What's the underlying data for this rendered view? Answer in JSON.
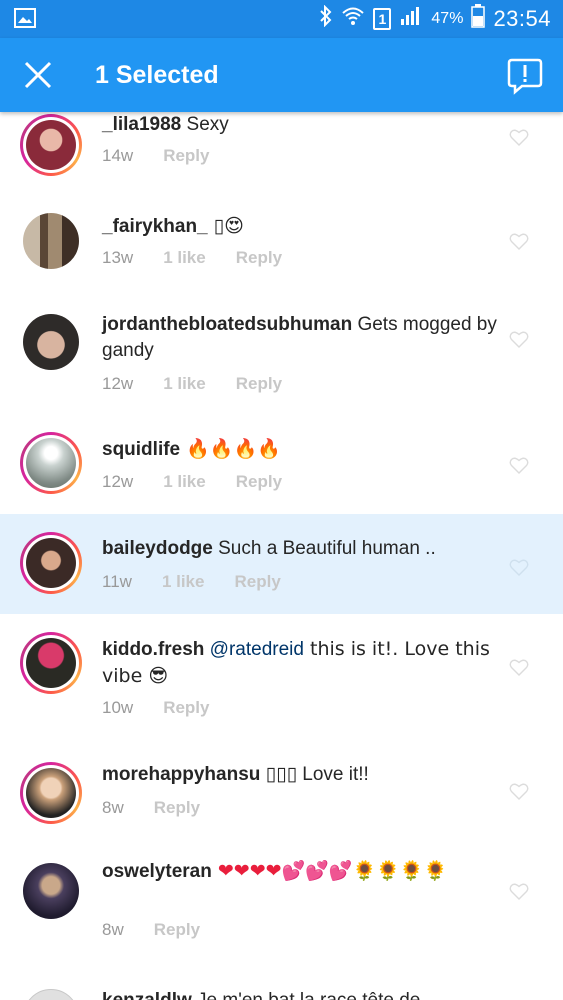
{
  "status_bar": {
    "sim": "1",
    "battery": "47%",
    "time": "23:54"
  },
  "action_bar": {
    "title": "1 Selected"
  },
  "comments": [
    {
      "username": "_lila1988",
      "text": " Sexy",
      "time": "14w",
      "likes": "",
      "reply": "Reply",
      "story": true,
      "selected": false,
      "avatar_color": "#8a2a3a"
    },
    {
      "username": "_fairykhan_",
      "text": " ▯😍",
      "time": "13w",
      "likes": "1 like",
      "reply": "Reply",
      "story": false,
      "selected": false,
      "avatar_color": "#7a6450"
    },
    {
      "username": "jordanthebloatedsubhuman",
      "text": " Gets mogged by gandy",
      "time": "12w",
      "likes": "1 like",
      "reply": "Reply",
      "story": false,
      "selected": false,
      "avatar_color": "#5a5550"
    },
    {
      "username": "squidlife",
      "text": " 🔥🔥🔥🔥",
      "time": "12w",
      "likes": "1 like",
      "reply": "Reply",
      "story": true,
      "selected": false,
      "avatar_color": "#9aa3a0"
    },
    {
      "username": "baileydodge",
      "text": " Such a Beautiful human ..",
      "time": "11w",
      "likes": "1 like",
      "reply": "Reply",
      "story": true,
      "selected": true,
      "avatar_color": "#3b2a26"
    },
    {
      "username": "kiddo.fresh",
      "mention": " @ratedreid",
      "text": " this is it!. Love this vibe 😎",
      "time": "10w",
      "likes": "",
      "reply": "Reply",
      "story": true,
      "selected": false,
      "avatar_color": "#3a2a2a"
    },
    {
      "username": "morehappyhansu",
      "text": " ▯▯▯ Love it!!",
      "time": "8w",
      "likes": "",
      "reply": "Reply",
      "story": true,
      "selected": false,
      "avatar_color": "#caa07a"
    },
    {
      "username": "oswelyteran",
      "text": " ❤❤❤❤💕💕💕🌻🌻🌻🌻",
      "time": "8w",
      "likes": "",
      "reply": "Reply",
      "story": false,
      "selected": false,
      "avatar_color": "#2a2640"
    },
    {
      "username": "kenzaldlw",
      "text": " Je m'en bat la race tête de",
      "time": "",
      "likes": "",
      "reply": "",
      "story": false,
      "selected": false,
      "avatar_color": "#dddddd"
    }
  ]
}
